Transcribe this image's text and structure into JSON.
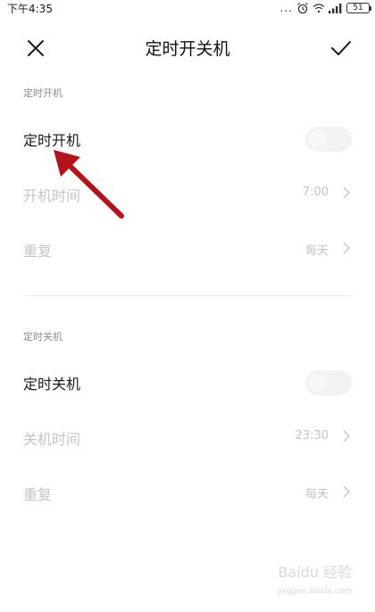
{
  "status_bar": {
    "time": "下午4:35",
    "dots": "...",
    "battery": "51",
    "icons": [
      "alarm-icon",
      "wifi-icon",
      "signal-icon",
      "battery-icon"
    ]
  },
  "header": {
    "title": "定时开关机",
    "close_icon": "close-icon",
    "confirm_icon": "check-icon"
  },
  "power_on": {
    "section_label": "定时开机",
    "toggle_label": "定时开机",
    "toggle_on": false,
    "time_label": "开机时间",
    "time_value": "7:00",
    "repeat_label": "重复",
    "repeat_value": "每天"
  },
  "power_off": {
    "section_label": "定时关机",
    "toggle_label": "定时关机",
    "toggle_on": false,
    "time_label": "关机时间",
    "time_value": "23:30",
    "repeat_label": "重复",
    "repeat_value": "每天"
  },
  "annotation": {
    "arrow_color": "#b3141c"
  },
  "watermark": {
    "text": "Baidu 经验",
    "sub": "jingyan.baidu.com"
  },
  "colors": {
    "text_primary": "#1a1a1a",
    "text_disabled": "#c4c4c4",
    "section_label": "#8c8c8c",
    "toggle_off": "#f2f2f2"
  }
}
